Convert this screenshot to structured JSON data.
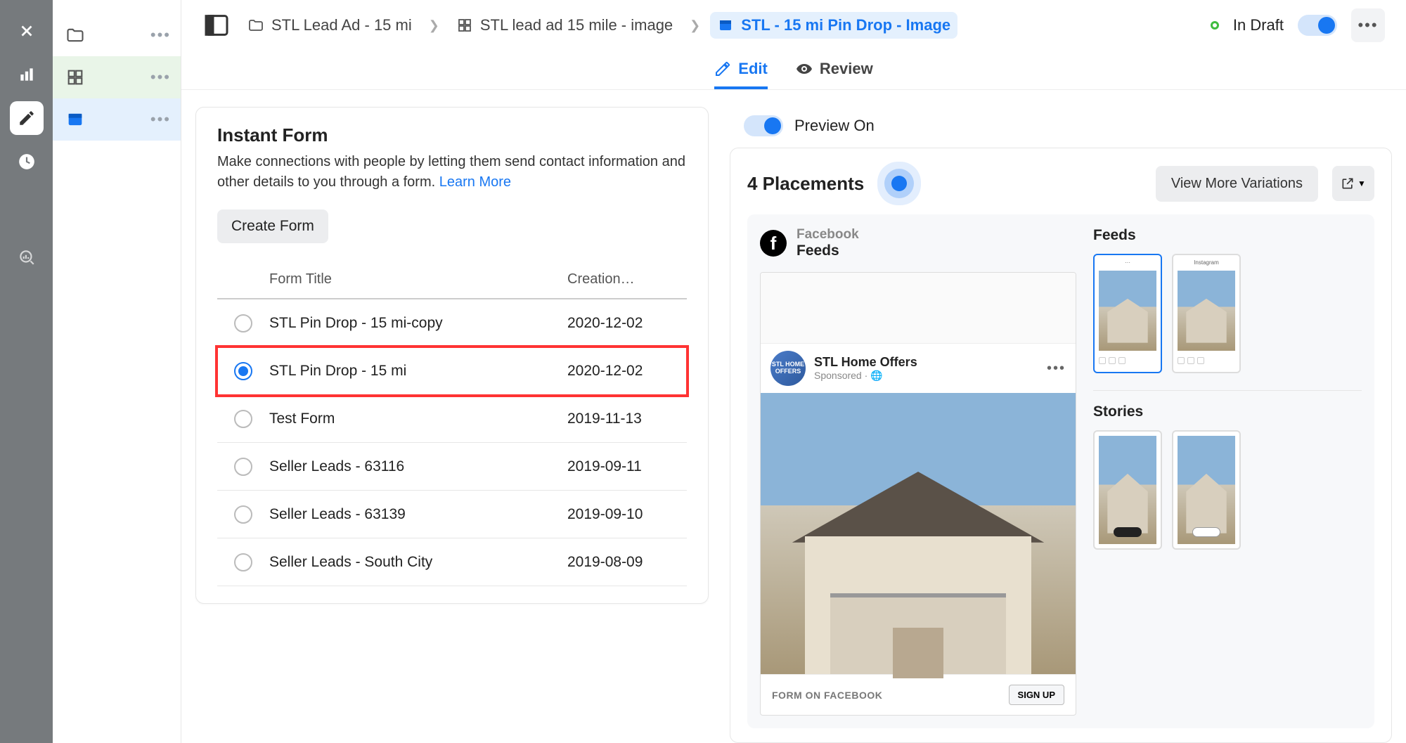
{
  "breadcrumbs": {
    "level1": "STL Lead Ad - 15 mi",
    "level2": "STL lead ad 15 mile - image",
    "level3": "STL - 15 mi Pin Drop - Image"
  },
  "status": "In Draft",
  "tabs": {
    "edit": "Edit",
    "review": "Review"
  },
  "instant_form": {
    "title": "Instant Form",
    "subtitle": "Make connections with people by letting them send contact information and other details to you through a form. ",
    "learn_more": "Learn More",
    "create_btn": "Create Form",
    "col_title": "Form Title",
    "col_date": "Creation…",
    "rows": [
      {
        "title": "STL Pin Drop - 15 mi-copy",
        "date": "2020-12-02",
        "selected": false
      },
      {
        "title": "STL Pin Drop - 15 mi",
        "date": "2020-12-02",
        "selected": true
      },
      {
        "title": "Test Form",
        "date": "2019-11-13",
        "selected": false
      },
      {
        "title": "Seller Leads - 63116",
        "date": "2019-09-11",
        "selected": false
      },
      {
        "title": "Seller Leads - 63139",
        "date": "2019-09-10",
        "selected": false
      },
      {
        "title": "Seller Leads - South City",
        "date": "2019-08-09",
        "selected": false
      }
    ]
  },
  "preview": {
    "toggle_label": "Preview On",
    "placements": "4 Placements",
    "view_more": "View More Variations",
    "platform_name": "Facebook",
    "platform_type": "Feeds",
    "advertiser": "STL Home Offers",
    "sponsored": "Sponsored · 🌐",
    "footer_text": "FORM ON FACEBOOK",
    "signup": "SIGN UP",
    "section_feeds": "Feeds",
    "section_stories": "Stories"
  }
}
